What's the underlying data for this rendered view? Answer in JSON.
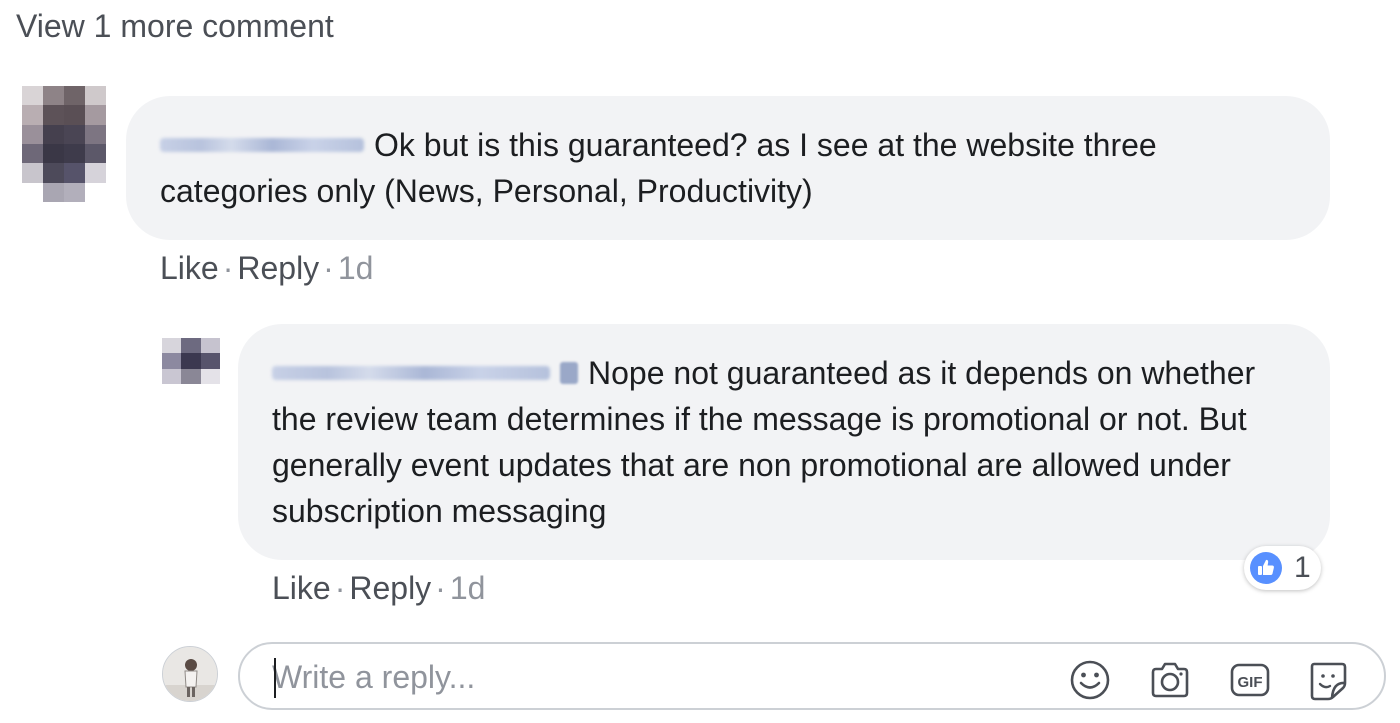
{
  "thread": {
    "view_more_label": "View 1 more comment"
  },
  "comments": [
    {
      "text": "Ok but is this guaranteed? as I see at the website three categories only (News, Personal, Productivity)",
      "like_label": "Like",
      "reply_label": "Reply",
      "time": "1d"
    },
    {
      "text": "Nope not guaranteed as it depends on whether the review team determines if the message is promotional or not. But generally event updates that are non promotional are allowed under subscription messaging",
      "like_label": "Like",
      "reply_label": "Reply",
      "time": "1d",
      "reaction_count": "1",
      "reaction_icon": "thumbs-up-icon"
    }
  ],
  "composer": {
    "placeholder": "Write a reply...",
    "icons": [
      "smiley-icon",
      "camera-icon",
      "gif-icon",
      "sticker-icon"
    ]
  },
  "colors": {
    "bubble": "#f2f3f5",
    "like_blue": "#5890ff",
    "muted_text": "#90949c",
    "action_text": "#4b4f56"
  }
}
